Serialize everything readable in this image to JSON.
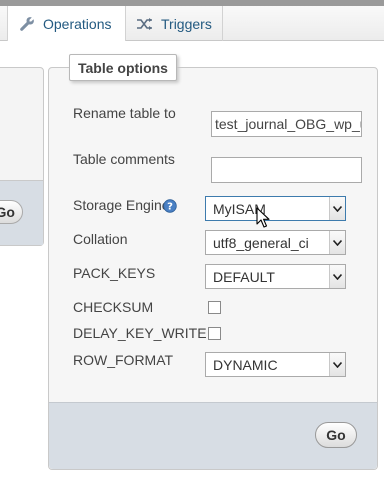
{
  "tabs": [
    {
      "label": "Operations",
      "icon": "wrench-icon"
    },
    {
      "label": "Triggers",
      "icon": "triggers-icon"
    }
  ],
  "left_panel": {
    "go_label": "Go"
  },
  "table_options": {
    "legend": "Table options",
    "rename_label": "Rename table to",
    "rename_value": "test_journal_OBG_wp_u",
    "comments_label": "Table comments",
    "comments_value": "",
    "storage_label": "Storage Engine",
    "storage_value": "MyISAM",
    "collation_label": "Collation",
    "collation_value": "utf8_general_ci",
    "pack_keys_label": "PACK_KEYS",
    "pack_keys_value": "DEFAULT",
    "checksum_label": "CHECKSUM",
    "checksum_checked": false,
    "delay_key_write_label": "DELAY_KEY_WRITE",
    "delay_key_write_checked": false,
    "row_format_label": "ROW_FORMAT",
    "row_format_value": "DYNAMIC",
    "go_label": "Go"
  },
  "colors": {
    "link": "#235a81",
    "footer": "#d7dde4",
    "help_icon": "#4a80c4"
  }
}
